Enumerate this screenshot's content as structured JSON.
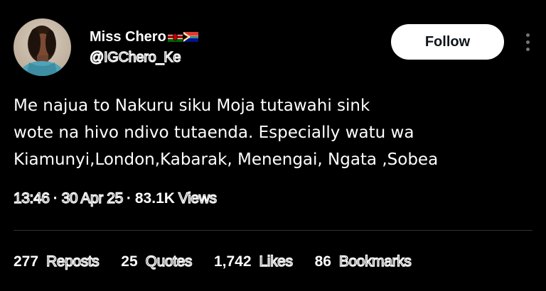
{
  "author": {
    "display_name": "Miss Chero",
    "handle": "@IGChero_Ke",
    "flags": [
      "kenya-flag-icon",
      "south-africa-flag-icon"
    ]
  },
  "follow_button": {
    "label": "Follow"
  },
  "more_menu": {
    "icon": "more-vertical-icon"
  },
  "tweet": {
    "lines": [
      "Me najua to Nakuru siku Moja tutawahi sink",
      "wote na hivo ndivo tutaenda. Especially watu wa",
      "Kiamunyi,London,Kabarak, Menengai, Ngata ,Sobea"
    ]
  },
  "meta": {
    "time": "13:46",
    "date": "30 Apr 25",
    "views_count": "83.1K",
    "views_label": "Views",
    "separator": "·"
  },
  "stats": [
    {
      "count": "277",
      "label": "Reposts"
    },
    {
      "count": "25",
      "label": "Quotes"
    },
    {
      "count": "1,742",
      "label": "Likes"
    },
    {
      "count": "86",
      "label": "Bookmarks"
    }
  ],
  "colors": {
    "background": "#000000",
    "text": "#ffffff",
    "secondary": "#71767b",
    "divider": "#2f3336",
    "button_bg": "#ffffff",
    "button_text": "#0f1419"
  }
}
